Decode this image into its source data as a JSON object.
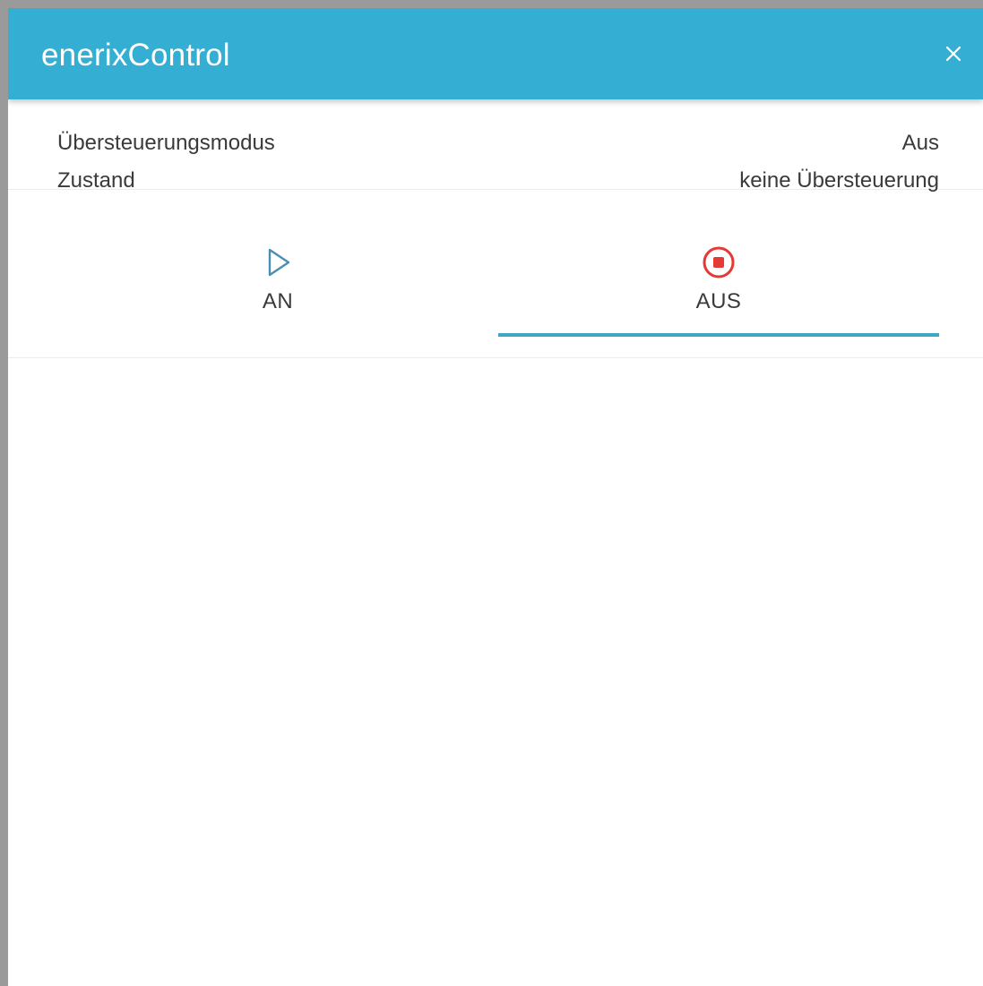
{
  "dialog": {
    "title": "enerixControl",
    "close_icon": "close-icon"
  },
  "info": {
    "rows": [
      {
        "label": "Übersteuerungsmodus",
        "value": "Aus"
      },
      {
        "label": "Zustand",
        "value": "keine Übersteuerung"
      }
    ]
  },
  "tabs": [
    {
      "label": "AN",
      "icon": "play-icon",
      "icon_color": "#4a8fb3",
      "selected": false
    },
    {
      "label": "AUS",
      "icon": "stop-icon",
      "icon_color": "#e53935",
      "selected": true
    }
  ],
  "colors": {
    "header": "#35aed3",
    "underline": "#3ea8c4"
  }
}
